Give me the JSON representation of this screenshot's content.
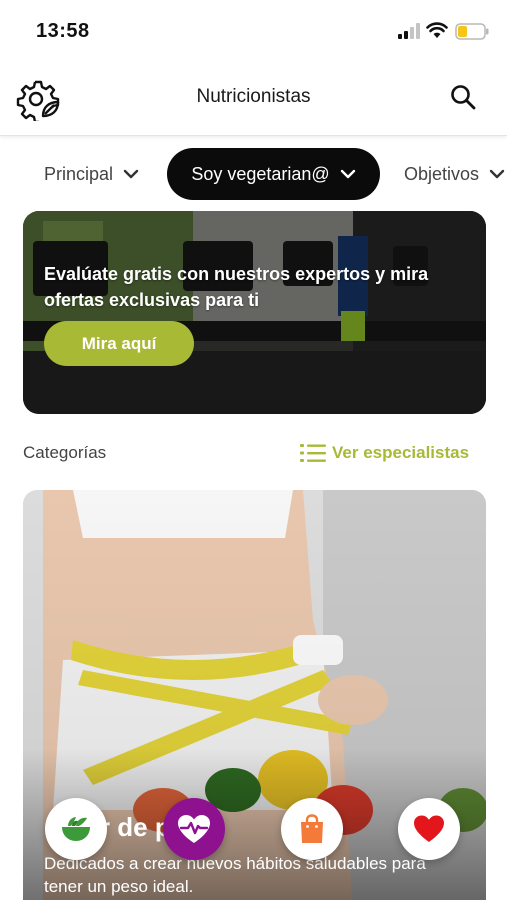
{
  "status_bar": {
    "time": "13:58",
    "icons": [
      "signal-icon",
      "wifi-icon",
      "battery-icon"
    ]
  },
  "header": {
    "title": "Nutricionistas",
    "left_icon": "gear-leaf-icon",
    "right_icon": "search-icon"
  },
  "filters": {
    "chips": [
      {
        "label": "Principal",
        "active": false
      },
      {
        "label": "Soy vegetarian@",
        "active": true
      },
      {
        "label": "Objetivos",
        "active": false
      }
    ]
  },
  "promo": {
    "text": "Evalúate gratis con nuestros expertos y mira ofertas exclusivas para ti",
    "button_label": "Mira aquí"
  },
  "categories": {
    "title": "Categorías",
    "see_specialists_label": "Ver especialistas",
    "card": {
      "title": "Bajar de peso",
      "description": "Dedicados a crear nuevos hábitos saludables para tener un peso ideal."
    }
  },
  "floating_actions": [
    {
      "icon": "salad-bowl-icon"
    },
    {
      "icon": "heart-pulse-icon"
    },
    {
      "icon": "shopping-bag-icon"
    },
    {
      "icon": "heart-icon"
    }
  ],
  "colors": {
    "accent": "#a8b936",
    "dark_chip": "#0b0b0b",
    "purple": "#8e1290",
    "orange": "#f47a3a",
    "red": "#e3161c",
    "green_icon": "#3d9a3a"
  }
}
